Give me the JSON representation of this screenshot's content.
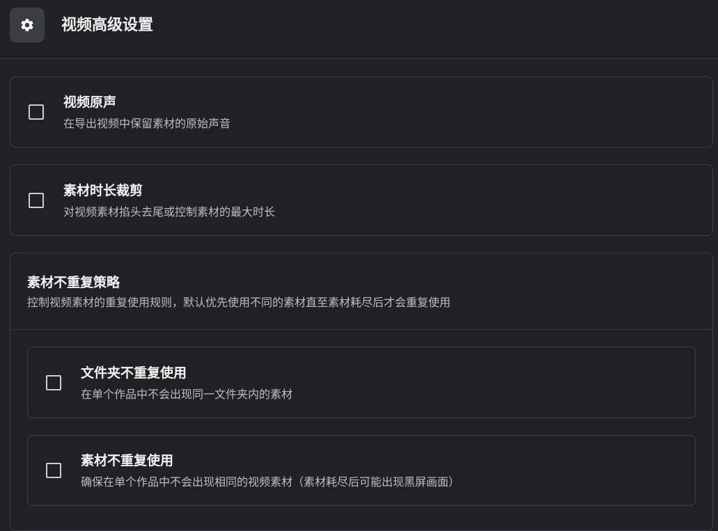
{
  "header": {
    "icon": "gear-icon",
    "title": "视频高级设置"
  },
  "options": {
    "original_audio": {
      "title": "视频原声",
      "description": "在导出视频中保留素材的原始声音",
      "checked": false
    },
    "duration_trim": {
      "title": "素材时长裁剪",
      "description": "对视频素材掐头去尾或控制素材的最大时长",
      "checked": false
    }
  },
  "no_repeat_strategy": {
    "title": "素材不重复策略",
    "description": "控制视频素材的重复使用规则，默认优先使用不同的素材直至素材耗尽后才会重复使用",
    "folder_no_repeat": {
      "title": "文件夹不重复使用",
      "description": "在单个作品中不会出现同一文件夹内的素材",
      "checked": false
    },
    "material_no_repeat": {
      "title": "素材不重复使用",
      "description": "确保在单个作品中不会出现相同的视频素材（素材耗尽后可能出现黑屏画面）",
      "checked": false
    }
  },
  "colors": {
    "background": "#222226",
    "border": "#3f3f45",
    "icon_bg": "#3c3d42"
  }
}
